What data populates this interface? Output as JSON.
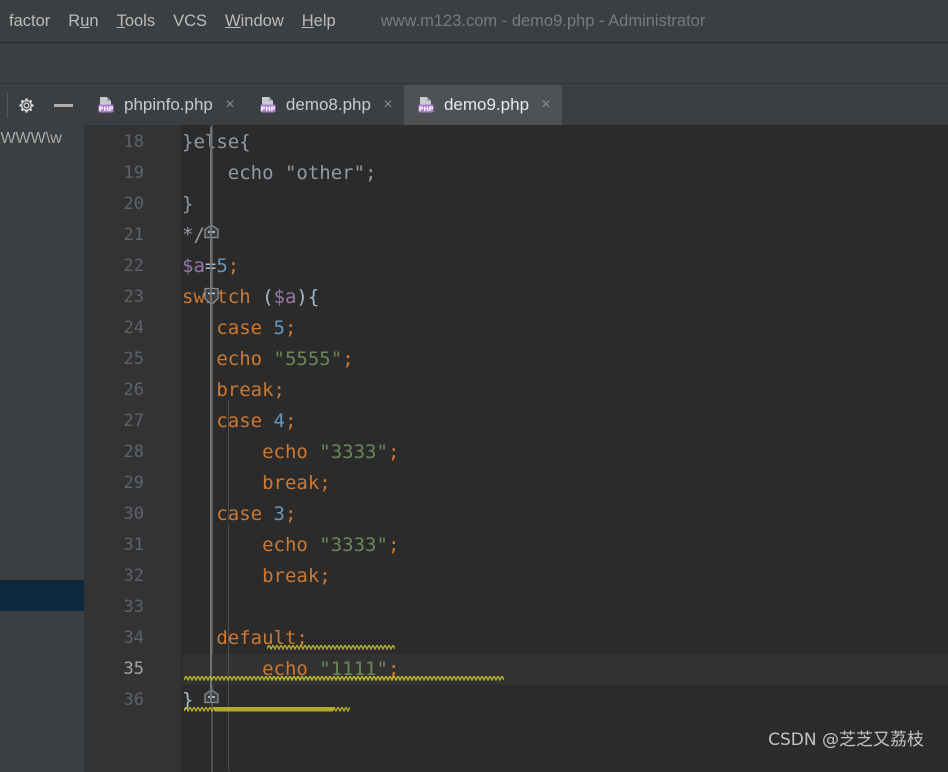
{
  "window": {
    "title": "www.m123.com - demo9.php - Administrator"
  },
  "menubar": {
    "items": [
      {
        "label": "factor",
        "mnemonic": ""
      },
      {
        "label": "Run",
        "mnemonic": "u"
      },
      {
        "label": "Tools",
        "mnemonic": "T"
      },
      {
        "label": "VCS",
        "mnemonic": ""
      },
      {
        "label": "Window",
        "mnemonic": "W"
      },
      {
        "label": "Help",
        "mnemonic": "H"
      }
    ]
  },
  "project_panel": {
    "gear_icon": "gear-icon",
    "collapse_icon": "minimize-icon",
    "path_text": "\\WWW\\w"
  },
  "tabs": [
    {
      "label": "phpinfo.php",
      "icon": "php-file-icon",
      "close": "×",
      "active": false
    },
    {
      "label": "demo8.php",
      "icon": "php-file-icon",
      "close": "×",
      "active": false
    },
    {
      "label": "demo9.php",
      "icon": "php-file-icon",
      "close": "×",
      "active": true
    }
  ],
  "editor": {
    "current_line": 35,
    "lines": [
      {
        "n": 18,
        "tokens": [
          {
            "t": "}else{",
            "c": "cmt2"
          }
        ],
        "indent": 0,
        "fold": null
      },
      {
        "n": 19,
        "tokens": [
          {
            "t": "    echo \"other\";",
            "c": "cmt2"
          }
        ],
        "indent": 0,
        "fold": null
      },
      {
        "n": 20,
        "tokens": [
          {
            "t": "}",
            "c": "cmt2"
          }
        ],
        "indent": 0,
        "fold": null
      },
      {
        "n": 21,
        "tokens": [
          {
            "t": "*/",
            "c": "cmt2"
          }
        ],
        "indent": 0,
        "fold": "end"
      },
      {
        "n": 22,
        "tokens": [
          {
            "t": "$a",
            "c": "var"
          },
          {
            "t": "=",
            "c": "pl"
          },
          {
            "t": "5",
            "c": "num"
          },
          {
            "t": ";",
            "c": "kw"
          }
        ],
        "indent": 0,
        "fold": null
      },
      {
        "n": 23,
        "tokens": [
          {
            "t": "switch",
            "c": "kw"
          },
          {
            "t": " (",
            "c": "pl"
          },
          {
            "t": "$a",
            "c": "var"
          },
          {
            "t": "){",
            "c": "pl"
          }
        ],
        "indent": 0,
        "fold": "start"
      },
      {
        "n": 24,
        "tokens": [
          {
            "t": "   ",
            "c": "pl"
          },
          {
            "t": "case",
            "c": "kw"
          },
          {
            "t": " ",
            "c": "pl"
          },
          {
            "t": "5",
            "c": "num"
          },
          {
            "t": ";",
            "c": "kw"
          }
        ],
        "indent": 0,
        "fold": null
      },
      {
        "n": 25,
        "tokens": [
          {
            "t": "   ",
            "c": "pl"
          },
          {
            "t": "echo",
            "c": "kw"
          },
          {
            "t": " ",
            "c": "pl"
          },
          {
            "t": "\"5555\"",
            "c": "str"
          },
          {
            "t": ";",
            "c": "kw"
          }
        ],
        "indent": 0,
        "fold": null
      },
      {
        "n": 26,
        "tokens": [
          {
            "t": "   ",
            "c": "pl"
          },
          {
            "t": "break",
            "c": "kw"
          },
          {
            "t": ";",
            "c": "kw"
          }
        ],
        "indent": 0,
        "fold": null
      },
      {
        "n": 27,
        "tokens": [
          {
            "t": "   ",
            "c": "pl"
          },
          {
            "t": "case",
            "c": "kw"
          },
          {
            "t": " ",
            "c": "pl"
          },
          {
            "t": "4",
            "c": "num"
          },
          {
            "t": ";",
            "c": "kw"
          }
        ],
        "indent": 0,
        "fold": null
      },
      {
        "n": 28,
        "tokens": [
          {
            "t": "       ",
            "c": "pl"
          },
          {
            "t": "echo",
            "c": "kw"
          },
          {
            "t": " ",
            "c": "pl"
          },
          {
            "t": "\"3333\"",
            "c": "str"
          },
          {
            "t": ";",
            "c": "kw"
          }
        ],
        "indent": 0,
        "fold": null
      },
      {
        "n": 29,
        "tokens": [
          {
            "t": "       ",
            "c": "pl"
          },
          {
            "t": "break",
            "c": "kw"
          },
          {
            "t": ";",
            "c": "kw"
          }
        ],
        "indent": 0,
        "fold": null
      },
      {
        "n": 30,
        "tokens": [
          {
            "t": "   ",
            "c": "pl"
          },
          {
            "t": "case",
            "c": "kw"
          },
          {
            "t": " ",
            "c": "pl"
          },
          {
            "t": "3",
            "c": "num"
          },
          {
            "t": ";",
            "c": "kw"
          }
        ],
        "indent": 0,
        "fold": null
      },
      {
        "n": 31,
        "tokens": [
          {
            "t": "       ",
            "c": "pl"
          },
          {
            "t": "echo",
            "c": "kw"
          },
          {
            "t": " ",
            "c": "pl"
          },
          {
            "t": "\"3333\"",
            "c": "str"
          },
          {
            "t": ";",
            "c": "kw"
          }
        ],
        "indent": 0,
        "fold": null
      },
      {
        "n": 32,
        "tokens": [
          {
            "t": "       ",
            "c": "pl"
          },
          {
            "t": "break",
            "c": "kw"
          },
          {
            "t": ";",
            "c": "kw"
          }
        ],
        "indent": 0,
        "fold": null
      },
      {
        "n": 33,
        "tokens": [],
        "indent": 0,
        "fold": null
      },
      {
        "n": 34,
        "tokens": [
          {
            "t": "   ",
            "c": "pl"
          },
          {
            "t": "default",
            "c": "kw"
          },
          {
            "t": ";",
            "c": "kw"
          }
        ],
        "indent": 0,
        "fold": null
      },
      {
        "n": 35,
        "tokens": [
          {
            "t": "       ",
            "c": "pl"
          },
          {
            "t": "echo",
            "c": "kw"
          },
          {
            "t": " ",
            "c": "pl"
          },
          {
            "t": "\"1111\"",
            "c": "str"
          },
          {
            "t": ";",
            "c": "kw"
          }
        ],
        "indent": 0,
        "fold": null
      },
      {
        "n": 36,
        "tokens": [
          {
            "t": "}",
            "c": "pl"
          }
        ],
        "indent": 0,
        "fold": "end"
      }
    ]
  },
  "watermark": {
    "text": "CSDN @芝芝又荔枝"
  },
  "colors": {
    "panel_bg": "#3c3f41",
    "editor_bg": "#2b2b2b",
    "gutter_bg": "#313335",
    "active_tab_bg": "#4e5254",
    "current_line_bg": "#323232",
    "selection_bg": "#0d293e",
    "keyword": "#cc7832",
    "string": "#6a8759",
    "number": "#6897bb",
    "variable": "#9876aa",
    "plain": "#a9b7c6",
    "warning_squiggle": "#bbb529"
  }
}
